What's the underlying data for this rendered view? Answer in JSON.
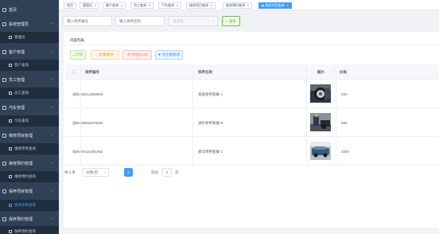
{
  "sidebar": {
    "items": [
      {
        "type": "parent",
        "label": "首页",
        "chevron": ""
      },
      {
        "type": "parent",
        "label": "系统管理员",
        "chevron": "⌃"
      },
      {
        "type": "child",
        "label": "管理员",
        "active": false
      },
      {
        "type": "parent",
        "label": "客户管理",
        "chevron": "⌃"
      },
      {
        "type": "child",
        "label": "客户查询",
        "active": false
      },
      {
        "type": "parent",
        "label": "员工管理",
        "chevron": "⌃"
      },
      {
        "type": "child",
        "label": "员工查询",
        "active": false
      },
      {
        "type": "parent",
        "label": "汽车管理",
        "chevron": "⌃"
      },
      {
        "type": "child",
        "label": "汽车查询",
        "active": false
      },
      {
        "type": "parent",
        "label": "维修项目管理",
        "chevron": "⌃"
      },
      {
        "type": "child",
        "label": "维修项目查询",
        "active": false
      },
      {
        "type": "parent",
        "label": "维修预约管理",
        "chevron": "⌃"
      },
      {
        "type": "child",
        "label": "维修预约查询",
        "active": false
      },
      {
        "type": "parent",
        "label": "保养项目管理",
        "chevron": "⌃"
      },
      {
        "type": "child",
        "label": "保养项目查询",
        "active": true
      },
      {
        "type": "parent",
        "label": "保养预约管理",
        "chevron": "⌃"
      },
      {
        "type": "child",
        "label": "保养预约查询",
        "active": false
      }
    ]
  },
  "tabs": [
    {
      "label": "首页",
      "active": false
    },
    {
      "label": "管理员",
      "active": false,
      "close": "×"
    },
    {
      "label": "客户查询",
      "active": false,
      "close": "×"
    },
    {
      "label": "员工查询",
      "active": false,
      "close": "×"
    },
    {
      "label": "汽车查询",
      "active": false,
      "close": "×"
    },
    {
      "label": "维修项目查询",
      "active": false,
      "close": "×"
    },
    {
      "label": "维修预约查询",
      "active": false,
      "close": "×"
    },
    {
      "label": "保养项目查询",
      "active": true,
      "close": "×"
    }
  ],
  "search": {
    "code_placeholder": "输入保养编号",
    "name_placeholder": "输入保养名称",
    "select_placeholder": "请选择",
    "button_label": "搜索"
  },
  "panel": {
    "title": "内容列表",
    "actions": {
      "print": "打印",
      "delete": "批量删除",
      "excel": "导出excel",
      "import": "导出数据表"
    }
  },
  "table": {
    "headers": {
      "code": "保养编号",
      "name": "保养名称",
      "image": "图片",
      "price": "价格"
    },
    "rows": [
      {
        "code": "828459214868806",
        "name": "基础保养套餐 A",
        "price": "330"
      },
      {
        "code": "828459852875683",
        "name": "进阶保养套餐 B",
        "price": "800"
      },
      {
        "code": "828459121061952",
        "name": "豪华保养套餐 C",
        "price": "3300"
      }
    ]
  },
  "pagination": {
    "total": "共 3 条",
    "page_size": "10条/页",
    "prev": "‹",
    "next": "›",
    "current_page": "1",
    "goto_label": "前往",
    "goto_value": "1",
    "goto_unit": "页"
  },
  "colors": {
    "accent": "#409eff",
    "sidebar_bg": "#304156"
  }
}
